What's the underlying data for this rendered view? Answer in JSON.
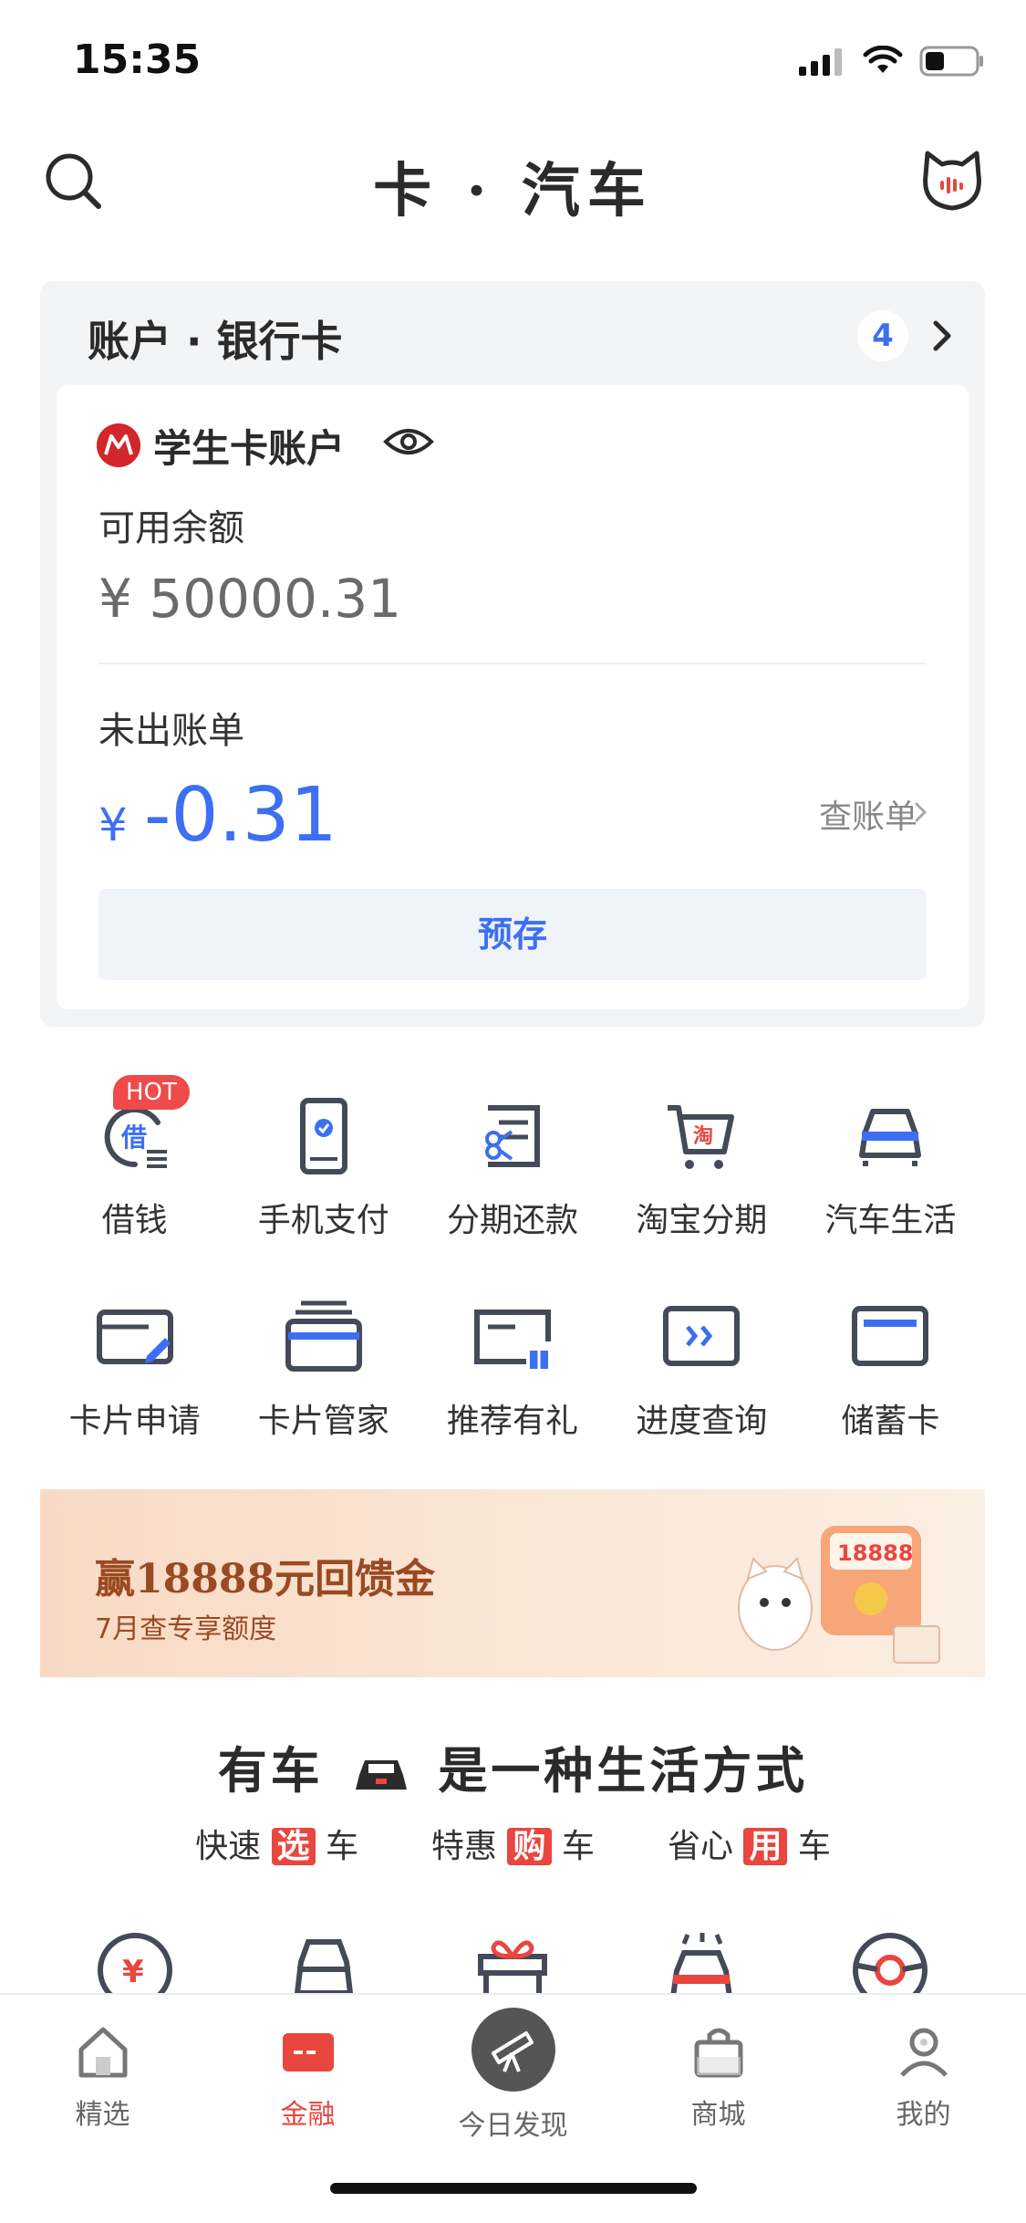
{
  "status_bar": {
    "time": "15:35"
  },
  "nav": {
    "title": "卡 · 汽车"
  },
  "account": {
    "header": "账户 · 银行卡",
    "count": "4",
    "card_name": "学生卡账户",
    "available_label": "可用余额",
    "available_value": "¥ 50000.31",
    "unbilled_label": "未出账单",
    "unbilled_currency": "¥",
    "unbilled_value": "-0.31",
    "view_bill": "查账单",
    "deposit": "预存"
  },
  "services_row1": [
    {
      "label": "借钱",
      "icon": "borrow-icon",
      "badge": "HOT"
    },
    {
      "label": "手机支付",
      "icon": "phone-pay-icon"
    },
    {
      "label": "分期还款",
      "icon": "installment-icon"
    },
    {
      "label": "淘宝分期",
      "icon": "taobao-cart-icon"
    },
    {
      "label": "汽车生活",
      "icon": "car-icon"
    }
  ],
  "services_row2": [
    {
      "label": "卡片申请",
      "icon": "card-apply-icon"
    },
    {
      "label": "卡片管家",
      "icon": "card-manager-icon"
    },
    {
      "label": "推荐有礼",
      "icon": "referral-icon"
    },
    {
      "label": "进度查询",
      "icon": "progress-icon"
    },
    {
      "label": "储蓄卡",
      "icon": "debit-card-icon"
    }
  ],
  "promo": {
    "title": "赢18888元回馈金",
    "subtitle": "7月查专享额度",
    "art_text": "18888"
  },
  "car_section": {
    "title_left": "有车",
    "title_right": "是一种生活方式",
    "items": [
      {
        "pre": "快速",
        "hl": "选",
        "post": "车"
      },
      {
        "pre": "特惠",
        "hl": "购",
        "post": "车"
      },
      {
        "pre": "省心",
        "hl": "用",
        "post": "车"
      }
    ]
  },
  "tabs": [
    {
      "label": "精选",
      "icon": "home-icon"
    },
    {
      "label": "金融",
      "icon": "card-icon",
      "active": true
    },
    {
      "label": "今日发现",
      "icon": "telescope-icon"
    },
    {
      "label": "商城",
      "icon": "bag-icon"
    },
    {
      "label": "我的",
      "icon": "profile-icon"
    }
  ],
  "colors": {
    "accent_blue": "#3d6ff2",
    "accent_red": "#e8463f"
  }
}
